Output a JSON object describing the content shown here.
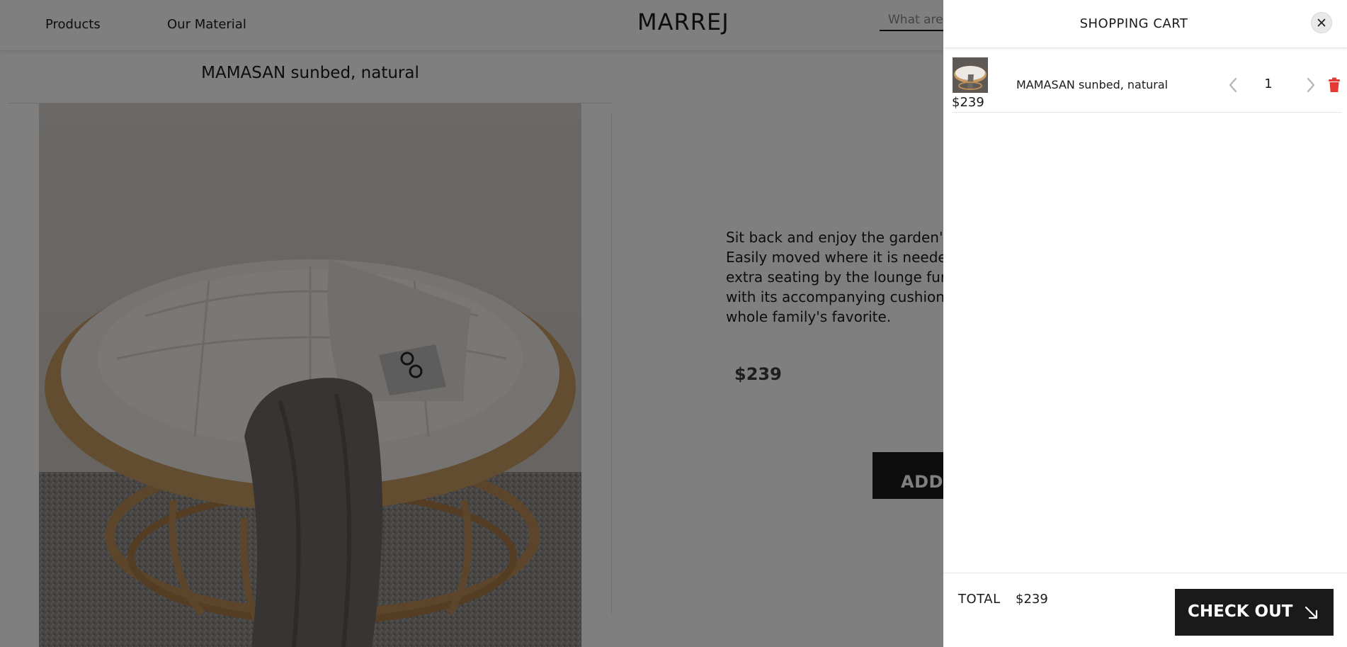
{
  "header": {
    "nav": [
      "Products",
      "Our Material"
    ],
    "brand": "MARREJ",
    "search_placeholder": "What are you looking for?"
  },
  "product": {
    "title": "MAMASAN sunbed, natural",
    "description": "Sit back and enjoy the garden's most relaxing spot. Easily moved where it is needed, the sunbed works as extra seating by the lounge furniture. Made of bamboo, with its accompanying cushion, it will become the whole family's favorite.",
    "price": "$239",
    "add_to_cart_label": "ADD TO CART",
    "image_icon": "sunbed-photo"
  },
  "cart": {
    "title": "SHOPPING CART",
    "close_icon": "close-icon",
    "items": [
      {
        "name": "MAMASAN sunbed, natural",
        "price": "$239",
        "quantity": "1"
      }
    ],
    "total_label": "TOTAL",
    "total_value": "$239",
    "checkout_label": "CHECK OUT",
    "checkout_icon": "arrow-down-right-icon"
  },
  "colors": {
    "accent": "#1a1a1a",
    "delete": "#e53935",
    "overlay": "rgba(0,0,0,0.5)"
  }
}
